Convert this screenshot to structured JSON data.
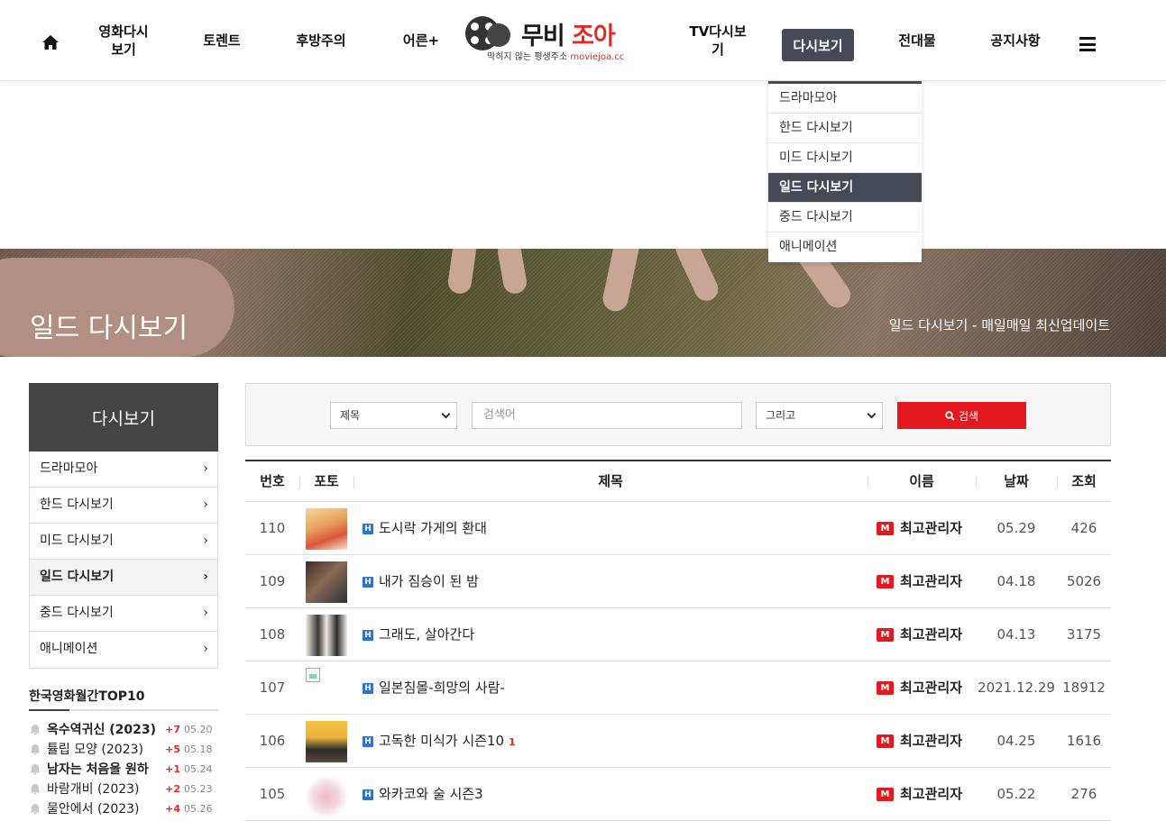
{
  "nav": {
    "items": [
      {
        "label_line1": "영화다시",
        "label_line2": "보기"
      },
      {
        "label_line1": "토렌트",
        "label_line2": ""
      },
      {
        "label_line1": "후방주의",
        "label_line2": ""
      },
      {
        "label_line1": "어른+",
        "label_line2": ""
      },
      {
        "label_line1": "TV다시보",
        "label_line2": "기"
      },
      {
        "label_line1": "다시보기",
        "label_line2": ""
      },
      {
        "label_line1": "전대물",
        "label_line2": ""
      },
      {
        "label_line1": "공지사항",
        "label_line2": ""
      }
    ],
    "logo_brand_1": "무비",
    "logo_brand_2": "조아",
    "logo_tagline": "막히지 않는 평생주소",
    "logo_domain": "moviejoa.cc"
  },
  "dropdown": {
    "items": [
      "드라마모아",
      "한드 다시보기",
      "미드 다시보기",
      "일드 다시보기",
      "중드 다시보기",
      "애니메이션"
    ],
    "active_index": 3
  },
  "banner": {
    "title": "일드 다시보기",
    "subtitle": "일드 다시보기 - 매일매일 최신업데이트"
  },
  "sidebar": {
    "title": "다시보기",
    "items": [
      "드라마모아",
      "한드 다시보기",
      "미드 다시보기",
      "일드 다시보기",
      "중드 다시보기",
      "애니메이션"
    ],
    "active_index": 3
  },
  "top10": {
    "title": "한국영화월간TOP10",
    "items": [
      {
        "title": "옥수역귀신 (2023)",
        "up": "+7",
        "date": "05.20",
        "bold": true
      },
      {
        "title": "튤립 모양 (2023)",
        "up": "+5",
        "date": "05.18",
        "bold": false
      },
      {
        "title": "남자는 처음을 원하",
        "up": "+1",
        "date": "05.24",
        "bold": true
      },
      {
        "title": "바람개비 (2023)",
        "up": "+2",
        "date": "05.23",
        "bold": false
      },
      {
        "title": "물안에서 (2023)",
        "up": "+4",
        "date": "05.26",
        "bold": false
      }
    ]
  },
  "search": {
    "field_select": "제목",
    "keyword_placeholder": "검색어",
    "operator_select": "그리고",
    "button_label": "검색"
  },
  "table": {
    "headers": [
      "번호",
      "포토",
      "제목",
      "이름",
      "날짜",
      "조회"
    ],
    "rows": [
      {
        "num": "110",
        "title": "도시락 가게의 환대",
        "comments": "",
        "author": "최고관리자",
        "date": "05.29",
        "views": "426"
      },
      {
        "num": "109",
        "title": "내가 짐승이 된 밤",
        "comments": "",
        "author": "최고관리자",
        "date": "04.18",
        "views": "5026"
      },
      {
        "num": "108",
        "title": "그래도, 살아간다",
        "comments": "",
        "author": "최고관리자",
        "date": "04.13",
        "views": "3175"
      },
      {
        "num": "107",
        "title": "일본침몰-희망의 사람-",
        "comments": "",
        "author": "최고관리자",
        "date": "2021.12.29",
        "views": "18912"
      },
      {
        "num": "106",
        "title": "고독한 미식가 시즌10",
        "comments": "1",
        "author": "최고관리자",
        "date": "04.25",
        "views": "1616"
      },
      {
        "num": "105",
        "title": "와카코와 술 시즌3",
        "comments": "",
        "author": "최고관리자",
        "date": "05.22",
        "views": "276"
      }
    ],
    "new_badge": "H",
    "author_badge": "M"
  },
  "colors": {
    "accent_red": "#e3191f",
    "nav_active_bg": "#454a56",
    "sidebar_head_bg": "#444444"
  }
}
